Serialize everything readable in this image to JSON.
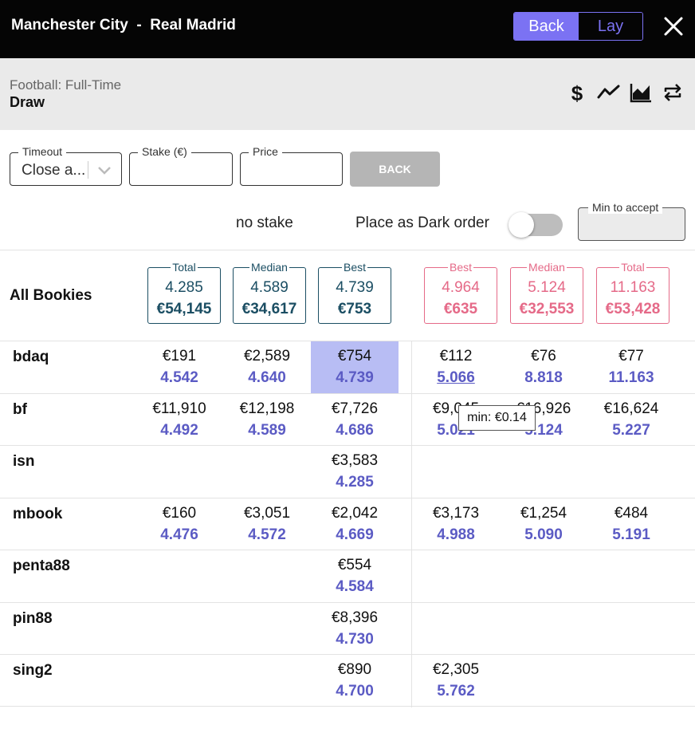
{
  "header": {
    "match_title": "Manchester City  -  Real Madrid",
    "back_label": "Back",
    "lay_label": "Lay"
  },
  "market": {
    "subtitle": "Football: Full-Time",
    "name": "Draw",
    "icons": [
      "dollar-icon",
      "line-chart-icon",
      "area-chart-icon",
      "swap-icon"
    ]
  },
  "form": {
    "timeout_label": "Timeout",
    "timeout_value": "Close a...",
    "stake_label": "Stake (€)",
    "stake_value": "",
    "price_label": "Price",
    "price_value": "",
    "submit_label": "BACK",
    "no_stake_text": "no stake",
    "dark_order_label": "Place as Dark order",
    "dark_order_on": false,
    "min_accept_label": "Min to accept",
    "min_accept_value": ""
  },
  "summary": {
    "label": "All Bookies",
    "back": [
      {
        "label": "Total",
        "price": "4.285",
        "amount": "€54,145"
      },
      {
        "label": "Median",
        "price": "4.589",
        "amount": "€34,617"
      },
      {
        "label": "Best",
        "price": "4.739",
        "amount": "€753"
      }
    ],
    "lay": [
      {
        "label": "Best",
        "price": "4.964",
        "amount": "€635"
      },
      {
        "label": "Median",
        "price": "5.124",
        "amount": "€32,553"
      },
      {
        "label": "Total",
        "price": "11.163",
        "amount": "€53,428"
      }
    ]
  },
  "bookies": [
    {
      "name": "bdaq",
      "back": [
        {
          "amt": "€191",
          "odds": "4.542"
        },
        {
          "amt": "€2,589",
          "odds": "4.640"
        },
        {
          "amt": "€754",
          "odds": "4.739"
        }
      ],
      "lay": [
        {
          "amt": "€112",
          "odds": "5.066"
        },
        {
          "amt": "€76",
          "odds": "8.818"
        },
        {
          "amt": "€77",
          "odds": "11.163"
        }
      ]
    },
    {
      "name": "bf",
      "back": [
        {
          "amt": "€11,910",
          "odds": "4.492"
        },
        {
          "amt": "€12,198",
          "odds": "4.589"
        },
        {
          "amt": "€7,726",
          "odds": "4.686"
        }
      ],
      "lay": [
        {
          "amt": "€9,045",
          "odds": "5.021"
        },
        {
          "amt": "€16,926",
          "odds": "5.124"
        },
        {
          "amt": "€16,624",
          "odds": "5.227"
        }
      ]
    },
    {
      "name": "isn",
      "back": [
        null,
        null,
        {
          "amt": "€3,583",
          "odds": "4.285"
        }
      ],
      "lay": [
        null,
        null,
        null
      ]
    },
    {
      "name": "mbook",
      "back": [
        {
          "amt": "€160",
          "odds": "4.476"
        },
        {
          "amt": "€3,051",
          "odds": "4.572"
        },
        {
          "amt": "€2,042",
          "odds": "4.669"
        }
      ],
      "lay": [
        {
          "amt": "€3,173",
          "odds": "4.988"
        },
        {
          "amt": "€1,254",
          "odds": "5.090"
        },
        {
          "amt": "€484",
          "odds": "5.191"
        }
      ]
    },
    {
      "name": "penta88",
      "back": [
        null,
        null,
        {
          "amt": "€554",
          "odds": "4.584"
        }
      ],
      "lay": [
        null,
        null,
        null
      ]
    },
    {
      "name": "pin88",
      "back": [
        null,
        null,
        {
          "amt": "€8,396",
          "odds": "4.730"
        }
      ],
      "lay": [
        null,
        null,
        null
      ]
    },
    {
      "name": "sing2",
      "back": [
        null,
        null,
        {
          "amt": "€890",
          "odds": "4.700"
        }
      ],
      "lay": [
        {
          "amt": "€2,305",
          "odds": "5.762"
        },
        null,
        null
      ]
    }
  ],
  "tooltip": "min: €0.14",
  "colors": {
    "accent": "#7b72f3",
    "back_box": "#1b4e63",
    "lay_box": "#e56a88",
    "odds": "#5b5bc4",
    "highlight": "#b8bdf4"
  }
}
